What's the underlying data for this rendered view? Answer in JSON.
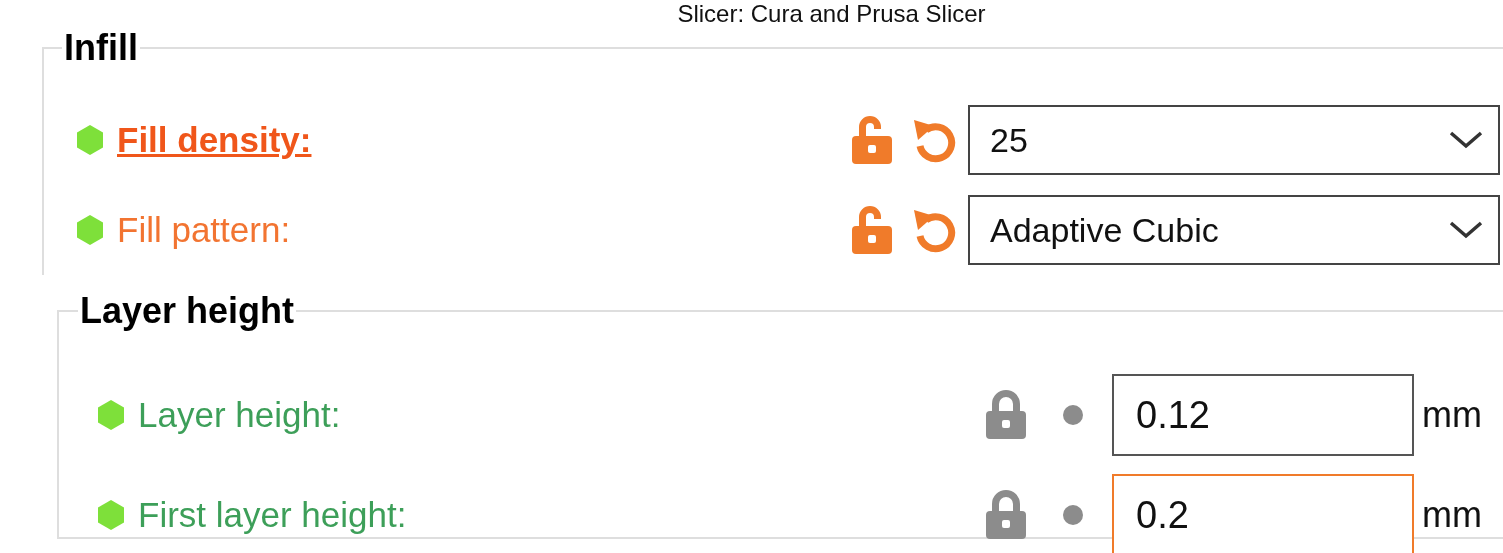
{
  "title": "Slicer: Cura and Prusa Slicer",
  "groups": [
    {
      "title": "Infill",
      "rows": [
        {
          "kind": "combo",
          "label": "Fill density:",
          "value": "25",
          "modified": true,
          "highlighted": true,
          "focused": false
        },
        {
          "kind": "combo",
          "label": "Fill pattern:",
          "value": "Adaptive Cubic",
          "modified": true,
          "highlighted": false,
          "focused": false
        }
      ]
    },
    {
      "title": "Layer height",
      "rows": [
        {
          "kind": "number",
          "label": "Layer height:",
          "value": "0.12",
          "unit": "mm",
          "modified": false,
          "highlighted": false,
          "focused": false
        },
        {
          "kind": "number",
          "label": "First layer height:",
          "value": "0.2",
          "unit": "mm",
          "modified": false,
          "highlighted": false,
          "focused": true
        }
      ]
    }
  ]
}
